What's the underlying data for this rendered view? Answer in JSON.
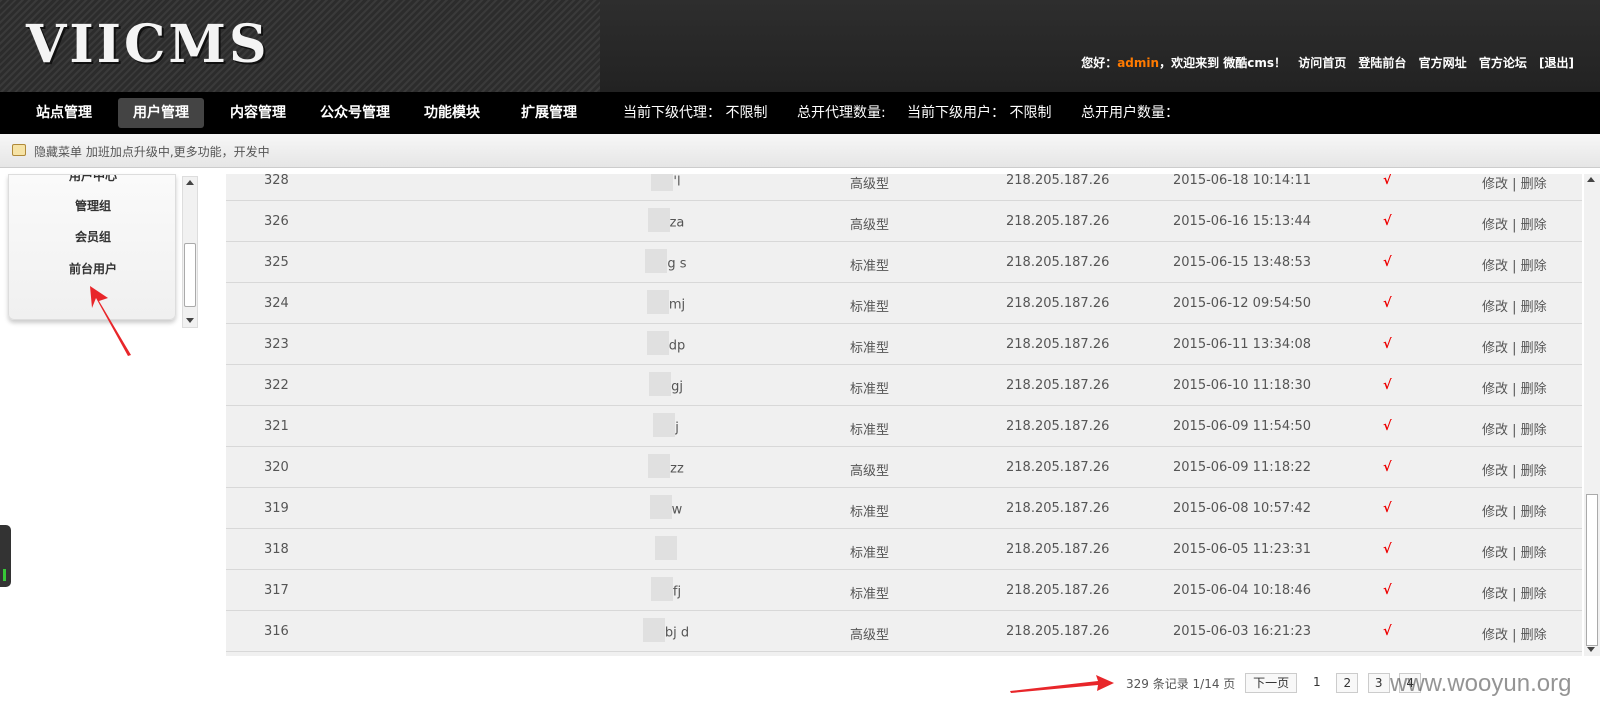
{
  "header": {
    "logo": "VIICMS",
    "greeting_prefix": "您好：",
    "user": "admin",
    "greeting_suffix": "，欢迎来到 微酷cms！",
    "links": [
      "访问首页",
      "登陆前台",
      "官方网址",
      "官方论坛",
      "[退出]"
    ]
  },
  "nav": {
    "items": [
      "站点管理",
      "用户管理",
      "内容管理",
      "公众号管理",
      "功能模块",
      "扩展管理"
    ],
    "active": "用户管理",
    "stats": [
      "当前下级代理： 不限制",
      "总开代理数量:",
      "当前下级用户： 不限制",
      "总开用户数量："
    ]
  },
  "subbar": {
    "text": "隐藏菜单 加班加点升级中,更多功能，开发中"
  },
  "sidebar": {
    "items": [
      "用户中心",
      "管理组",
      "会员组",
      "前台用户"
    ]
  },
  "table": {
    "rows": [
      {
        "id": "328",
        "name_part": "'l",
        "type": "高级型",
        "ip": "218.205.187.26",
        "time": "2015-06-18 10:14:11",
        "status": "√",
        "edit": "修改",
        "delete": "删除"
      },
      {
        "id": "326",
        "name_part": "za",
        "type": "高级型",
        "ip": "218.205.187.26",
        "time": "2015-06-16 15:13:44",
        "status": "√",
        "edit": "修改",
        "delete": "删除"
      },
      {
        "id": "325",
        "name_part": "g  s",
        "type": "标准型",
        "ip": "218.205.187.26",
        "time": "2015-06-15 13:48:53",
        "status": "√",
        "edit": "修改",
        "delete": "删除"
      },
      {
        "id": "324",
        "name_part": "mj",
        "type": "标准型",
        "ip": "218.205.187.26",
        "time": "2015-06-12 09:54:50",
        "status": "√",
        "edit": "修改",
        "delete": "删除"
      },
      {
        "id": "323",
        "name_part": "dp",
        "type": "标准型",
        "ip": "218.205.187.26",
        "time": "2015-06-11 13:34:08",
        "status": "√",
        "edit": "修改",
        "delete": "删除"
      },
      {
        "id": "322",
        "name_part": "gj",
        "type": "标准型",
        "ip": "218.205.187.26",
        "time": "2015-06-10 11:18:30",
        "status": "√",
        "edit": "修改",
        "delete": "删除"
      },
      {
        "id": "321",
        "name_part": "j",
        "type": "标准型",
        "ip": "218.205.187.26",
        "time": "2015-06-09 11:54:50",
        "status": "√",
        "edit": "修改",
        "delete": "删除"
      },
      {
        "id": "320",
        "name_part": "zz",
        "type": "高级型",
        "ip": "218.205.187.26",
        "time": "2015-06-09 11:18:22",
        "status": "√",
        "edit": "修改",
        "delete": "删除"
      },
      {
        "id": "319",
        "name_part": "w",
        "type": "标准型",
        "ip": "218.205.187.26",
        "time": "2015-06-08 10:57:42",
        "status": "√",
        "edit": "修改",
        "delete": "删除"
      },
      {
        "id": "318",
        "name_part": "",
        "type": "标准型",
        "ip": "218.205.187.26",
        "time": "2015-06-05 11:23:31",
        "status": "√",
        "edit": "修改",
        "delete": "删除"
      },
      {
        "id": "317",
        "name_part": "fj",
        "type": "标准型",
        "ip": "218.205.187.26",
        "time": "2015-06-04 10:18:46",
        "status": "√",
        "edit": "修改",
        "delete": "删除"
      },
      {
        "id": "316",
        "name_part": "bj  d",
        "type": "高级型",
        "ip": "218.205.187.26",
        "time": "2015-06-03 16:21:23",
        "status": "√",
        "edit": "修改",
        "delete": "删除"
      }
    ]
  },
  "pager": {
    "info": "329 条记录 1/14 页",
    "next": "下一页",
    "current": "1",
    "pages": [
      "2",
      "3",
      "4"
    ]
  },
  "watermark": "www.wooyun.org",
  "colors": {
    "accent_user": "#ff7a00",
    "check": "#e00000",
    "annotation_arrow": "#e8262a"
  }
}
